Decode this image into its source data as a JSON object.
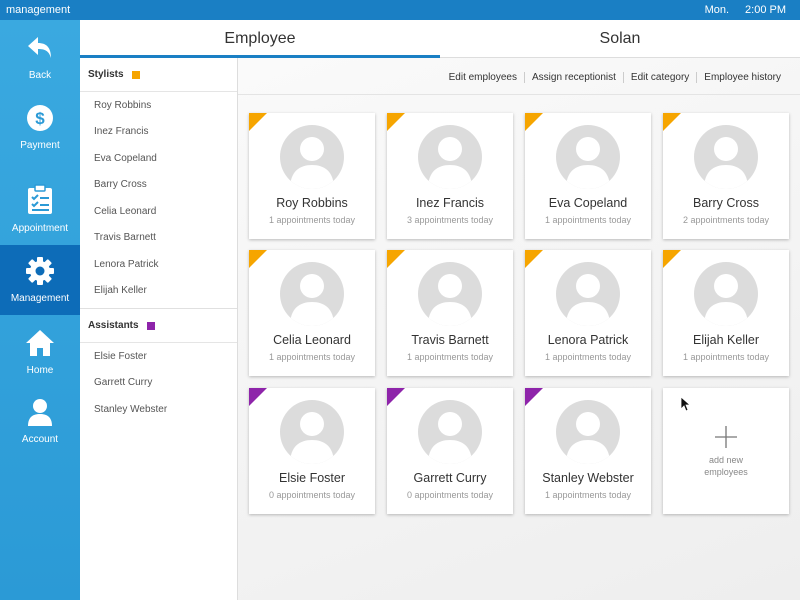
{
  "topbar": {
    "title": "management",
    "day": "Mon.",
    "time": "2:00 PM"
  },
  "nav": [
    {
      "label": "Back",
      "icon": "back-arrow-icon",
      "active": false
    },
    {
      "label": "Payment",
      "icon": "dollar-icon",
      "active": false
    },
    {
      "label": "Appointment",
      "icon": "clipboard-check-icon",
      "active": false
    },
    {
      "label": "Management",
      "icon": "gear-icon",
      "active": true
    },
    {
      "label": "Home",
      "icon": "home-icon",
      "active": false
    },
    {
      "label": "Account",
      "icon": "person-icon",
      "active": false
    }
  ],
  "tabs": [
    {
      "label": "Employee",
      "active": true
    },
    {
      "label": "Solan",
      "active": false
    }
  ],
  "groups": {
    "stylists": {
      "title": "Stylists",
      "color": "#f6a500",
      "members": [
        "Roy Robbins",
        "Inez Francis",
        "Eva Copeland",
        "Barry Cross",
        "Celia Leonard",
        "Travis Barnett",
        "Lenora Patrick",
        "Elijah Keller"
      ]
    },
    "assistants": {
      "title": "Assistants",
      "color": "#8e24aa",
      "members": [
        "Elsie Foster",
        "Garrett Curry",
        "Stanley Webster"
      ]
    }
  },
  "actions": [
    "Edit employees",
    "Assign receptionist",
    "Edit category",
    "Employee history"
  ],
  "cards": [
    {
      "name": "Roy Robbins",
      "appointments": "1 appointments today",
      "group": "stylists"
    },
    {
      "name": "Inez Francis",
      "appointments": "3 appointments today",
      "group": "stylists"
    },
    {
      "name": "Eva Copeland",
      "appointments": "1 appointments today",
      "group": "stylists"
    },
    {
      "name": "Barry Cross",
      "appointments": "2 appointments today",
      "group": "stylists"
    },
    {
      "name": "Celia Leonard",
      "appointments": "1 appointments today",
      "group": "stylists"
    },
    {
      "name": "Travis Barnett",
      "appointments": "1 appointments today",
      "group": "stylists"
    },
    {
      "name": "Lenora Patrick",
      "appointments": "1 appointments today",
      "group": "stylists"
    },
    {
      "name": "Elijah Keller",
      "appointments": "1 appointments today",
      "group": "stylists"
    },
    {
      "name": "Elsie Foster",
      "appointments": "0 appointments today",
      "group": "assistants"
    },
    {
      "name": "Garrett Curry",
      "appointments": "0 appointments today",
      "group": "assistants"
    },
    {
      "name": "Stanley Webster",
      "appointments": "1 appointments today",
      "group": "assistants"
    }
  ],
  "add_card": {
    "label": "add new employees"
  }
}
